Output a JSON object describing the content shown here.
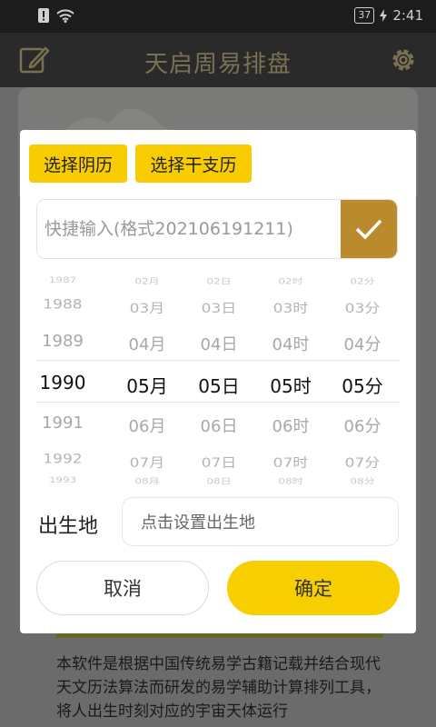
{
  "status_bar": {
    "battery": "37",
    "time": "2:41"
  },
  "header": {
    "title": "天启周易排盘",
    "edit_icon": "edit-icon",
    "settings_icon": "gear-icon"
  },
  "dialog": {
    "btn_lunar": "选择阴历",
    "btn_ganzhi": "选择干支历",
    "quick_input_placeholder": "快捷输入(格式202106191211)",
    "picker": {
      "years": [
        "1987",
        "1988",
        "1989",
        "1990",
        "1991",
        "1992",
        "1993"
      ],
      "months": [
        "02月",
        "03月",
        "04月",
        "05月",
        "06月",
        "07月",
        "08月"
      ],
      "days": [
        "02日",
        "03日",
        "04日",
        "05日",
        "06日",
        "07日",
        "08日"
      ],
      "hours": [
        "02时",
        "03时",
        "04时",
        "05时",
        "06时",
        "07时",
        "08时"
      ],
      "minutes": [
        "02分",
        "03分",
        "04分",
        "05分",
        "06分",
        "07分",
        "08分"
      ]
    },
    "birthplace_label": "出生地",
    "birthplace_placeholder": "点击设置出生地",
    "cancel": "取消",
    "confirm": "确定"
  },
  "background": {
    "intro_text": "本软件是根据中国传统易学古籍记载并结合现代天文历法算法而研发的易学辅助计算排列工具，将人出生时刻对应的宇宙天体运行"
  },
  "colors": {
    "accent": "#f7cc00",
    "ok_button": "#b98b2c"
  }
}
